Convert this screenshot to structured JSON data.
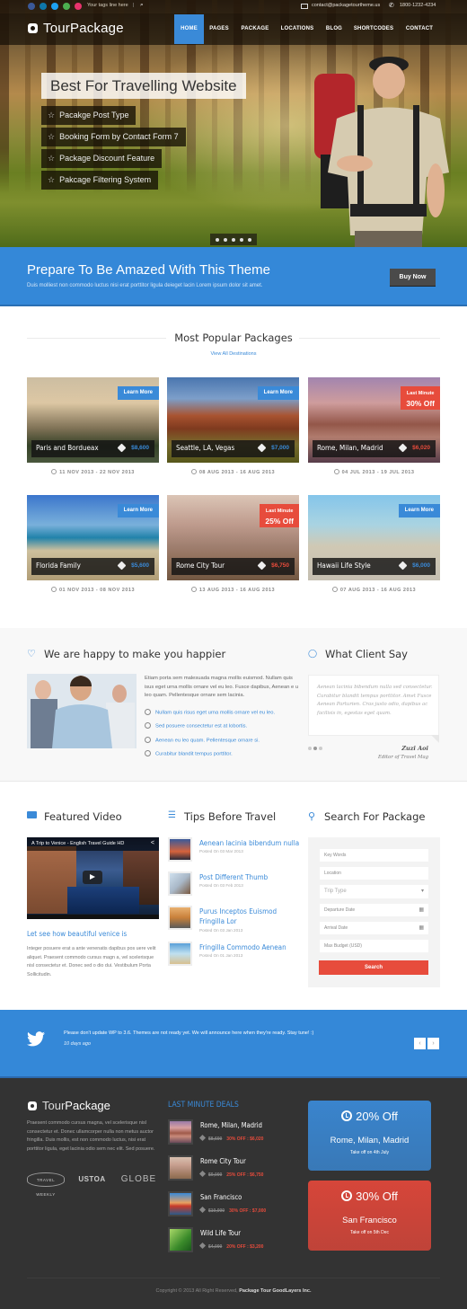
{
  "topbar": {
    "social": [
      {
        "name": "facebook-icon",
        "color": "#3b5998"
      },
      {
        "name": "linkedin-icon",
        "color": "#0e76a8"
      },
      {
        "name": "twitter-icon",
        "color": "#1da1f2"
      },
      {
        "name": "email-icon",
        "color": "#4caf50"
      },
      {
        "name": "dribbble-icon",
        "color": "#e8336d"
      }
    ],
    "tagline": "Your tags line here",
    "search_glyph": "⌕",
    "email": "contact@packagetourtheme.us",
    "phone_glyph": "✆",
    "phone": "1800-1232-4234"
  },
  "header": {
    "logo_part1": "Tour",
    "logo_part2": "Package",
    "nav": [
      {
        "label": "HOME",
        "active": true
      },
      {
        "label": "PAGES",
        "active": false
      },
      {
        "label": "PACKAGE",
        "active": false
      },
      {
        "label": "LOCATIONS",
        "active": false
      },
      {
        "label": "BLOG",
        "active": false
      },
      {
        "label": "SHORTCODES",
        "active": false
      },
      {
        "label": "CONTACT",
        "active": false
      }
    ]
  },
  "hero": {
    "title": "Best For Travelling Website",
    "star_glyph": "☆",
    "features": [
      "Pacakge Post Type",
      "Booking Form by Contact Form 7",
      "Package Discount Feature",
      "Pakcage Filtering System"
    ],
    "slide_count": 5,
    "active_slide": 1
  },
  "cta": {
    "title": "Prepare To Be Amazed With This Theme",
    "subtitle": "Duis molliest non commodo luctus nisi erat porttitor ligula deieget lacin Lorem ipsum dolor sit amet.",
    "button": "Buy Now"
  },
  "popular": {
    "title": "Most Popular Packages",
    "view_all": "View All Destinations",
    "packages": [
      {
        "name": "Paris and Bordueax",
        "price": "$8,600",
        "ribbon": "Learn More",
        "ribbon_type": "blue",
        "dates": "11 NOV 2013 - 22 NOV 2013",
        "scene": "paris"
      },
      {
        "name": "Seattle, LA, Vegas",
        "price": "$7,000",
        "ribbon": "Learn More",
        "ribbon_type": "blue",
        "dates": "08 AUG 2013 - 16 AUG 2013",
        "scene": "desert"
      },
      {
        "name": "Rome, Milan, Madrid",
        "price": "$6,020",
        "ribbon_line1": "Last Minute",
        "ribbon_line2": "30% Off",
        "ribbon_type": "red",
        "dates": "04 JUL 2013 - 19 JUL 2013",
        "scene": "venice"
      },
      {
        "name": "Florida Family",
        "price": "$5,600",
        "ribbon": "Learn More",
        "ribbon_type": "blue",
        "dates": "01 NOV 2013 - 08 NOV 2013",
        "scene": "beach"
      },
      {
        "name": "Rome City Tour",
        "price": "$6,750",
        "ribbon_line1": "Last Minute",
        "ribbon_line2": "25% Off",
        "ribbon_type": "red",
        "dates": "13 AUG 2013 - 16 AUG 2013",
        "scene": "trevi"
      },
      {
        "name": "Hawaii Life Style",
        "price": "$6,000",
        "ribbon": "Learn More",
        "ribbon_type": "blue",
        "dates": "07 AUG 2013 - 16 AUG 2013",
        "scene": "family"
      }
    ]
  },
  "happy": {
    "heading": "We are happy to make you happier",
    "heart_glyph": "♡",
    "paragraph": "Etiam porta sem malesuada magna mollis euismod. Nullam quis isus eget urna mollis ornare vel eu leo. Fusce dapibus, Aenean e u leo quam. Pellentesque ornare sem lacinia.",
    "list": [
      "Nullam quis risus eget urna mollis ornare vel eu leo.",
      "Sed posuere consectetur est at lobortis.",
      "Aenean eu leo quam. Pellentesque ornare si.",
      "Curabitur blandit tempus porttitor."
    ]
  },
  "client": {
    "heading": "What Client Say",
    "bubble_glyph": "💬",
    "quote": "Aenean lacinia bibendum nulla sed consectetur. Curabitur blandit tempus porttitor. Amet Fusce Aenean Parturien. Cras justo odio, dapibus ac facilisis in, egestas eget quam.",
    "author": "Zuzi Aoi",
    "role": "Editor of Travel Mag",
    "dot_count": 3,
    "active_dot": 2
  },
  "video": {
    "heading": "Featured Video",
    "video_title": "A Trip to Venice - English Travel Guide HD",
    "share_glyph": "<",
    "post_title": "Let see how beautiful venice is",
    "description": "Integer posuere erat a ante venenatis dapibus pos uere velit aliquet. Praesent commodo cursus magn a, vel scelerisque nisl consectetur et. Donec sed o dio dui. Vestibulum Porta Sollicitudin."
  },
  "tips": {
    "heading": "Tips Before Travel",
    "items": [
      {
        "title": "Aenean lacinia bibendum nulla",
        "date": "Posted On 03 Mar 2013"
      },
      {
        "title": "Post Different Thumb",
        "date": "Posted On 03 Feb 2013"
      },
      {
        "title": "Purus Inceptos Euismod Fringilla Lor",
        "date": "Posted On 03 Jan 2013"
      },
      {
        "title": "Fringilla Commodo Aenean",
        "date": "Posted On 01 Jan 2013"
      }
    ]
  },
  "search": {
    "heading": "Search For Package",
    "fields": [
      {
        "placeholder": "Key Words",
        "icon": ""
      },
      {
        "placeholder": "Location",
        "icon": ""
      },
      {
        "placeholder": "Trip Type",
        "icon": "▾"
      },
      {
        "placeholder": "Departure Date",
        "icon": "▦"
      },
      {
        "placeholder": "Arrival Date",
        "icon": "▦"
      },
      {
        "placeholder": "Max Budget (USD)",
        "icon": ""
      }
    ],
    "button": "Search"
  },
  "twitter": {
    "text": "Please don't update WP to 3.6. Themes are not ready yet. We will announce here when they're ready. Stay tune! :)",
    "time": "10 days ago",
    "prev": "‹",
    "next": "›"
  },
  "footer": {
    "logo_part1": "Tour",
    "logo_part2": "Package",
    "about": "Praesent commodo cursus magna, vel scelerisque nisl consectetur et. Donec ullamcorper nulla non metus auctor fringilla. Duis mollis, est non commodo luctus, nisi erat porttitor ligula, eget lacinia odio sem nec elit. Sed posuere.",
    "partners": [
      "TRAVEL WEEKLY",
      "USTOA",
      "GLOBE"
    ],
    "deals_title": "LAST MINUTE DEALS",
    "deals": [
      {
        "name": "Rome, Milan, Madrid",
        "old": "$8,600",
        "new": "30% OFF : $6,020",
        "scene": "venice"
      },
      {
        "name": "Rome City Tour",
        "old": "$9,000",
        "new": "25% OFF : $6,750",
        "scene": "trevi"
      },
      {
        "name": "San Francisco",
        "old": "$10,000",
        "new": "30% OFF : $7,000",
        "scene": "bridge"
      },
      {
        "name": "Wild Life Tour",
        "old": "$4,000",
        "new": "20% OFF : $3,200",
        "scene": "leaf"
      }
    ],
    "promos": [
      {
        "percent": "20% Off",
        "destination": "Rome, Milan, Madrid",
        "takeoff": "Take off on 4th July",
        "color": "#3a8ad8"
      },
      {
        "percent": "30% Off",
        "destination": "San Francisco",
        "takeoff": "Take off on 5th Dec",
        "color": "#e2473a"
      }
    ],
    "copyright_prefix": "Copyright © 2013 All Right Reserved, ",
    "copyright_brand": "Package Tour GoodLayers Inc."
  }
}
